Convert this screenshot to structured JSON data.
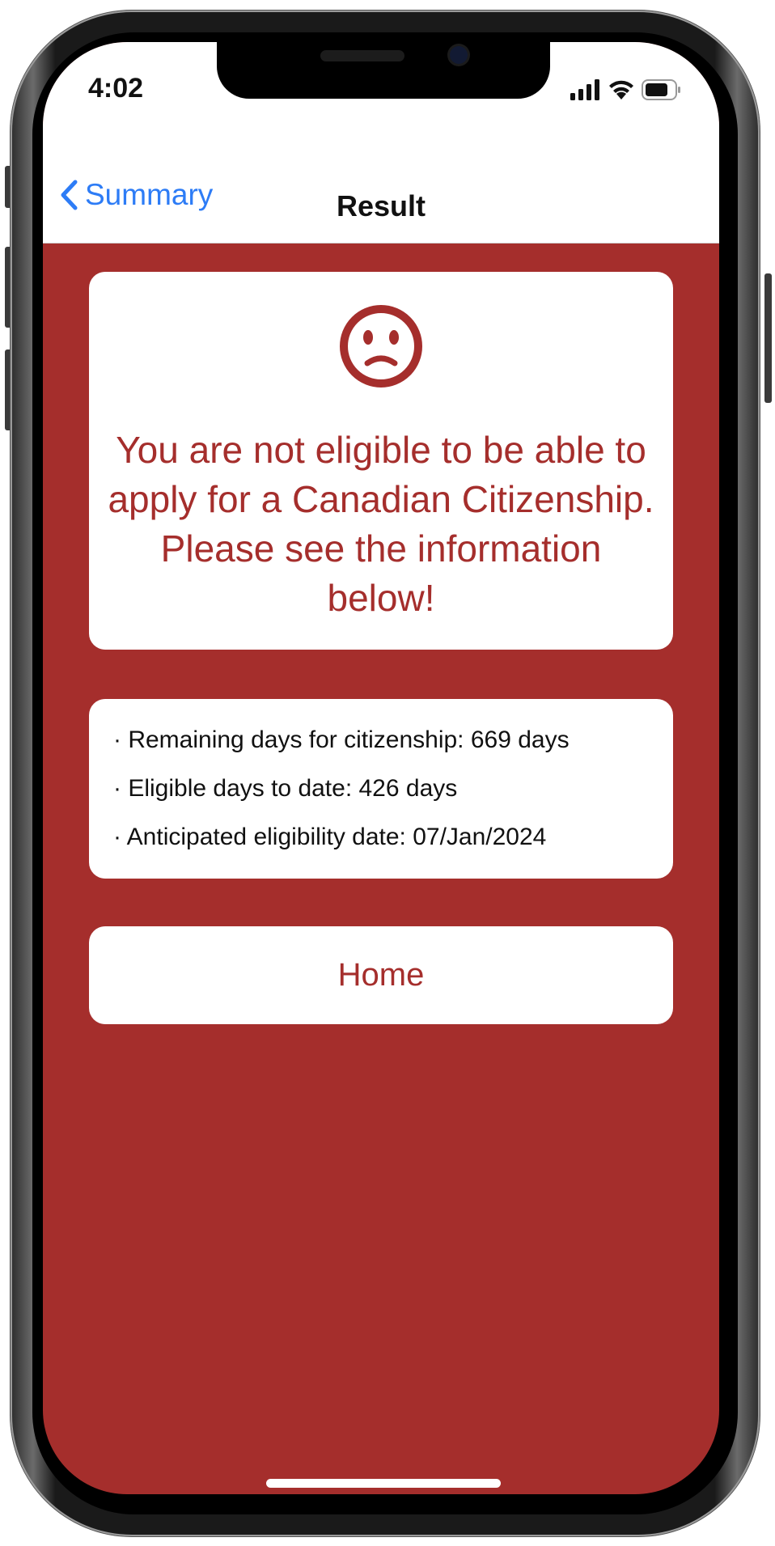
{
  "status_bar": {
    "time": "4:02"
  },
  "nav": {
    "back_label": "Summary",
    "title": "Result"
  },
  "result": {
    "icon": "sad-face-icon",
    "message": "You are not eligible to be able to apply for a Canadian Citizenship. Please see the information below!"
  },
  "info": {
    "items": [
      "· Remaining days for citizenship: 669 days",
      "· Eligible days to date: 426 days",
      "· Anticipated eligibility date: 07/Jan/2024"
    ]
  },
  "home_button": {
    "label": "Home"
  },
  "colors": {
    "accent_red": "#a52e2c",
    "ios_blue": "#2d7cf6",
    "card_bg": "#ffffff"
  }
}
